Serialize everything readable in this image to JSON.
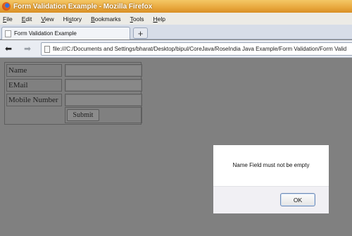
{
  "window": {
    "title": "Form Validation Example - Mozilla Firefox"
  },
  "menu": {
    "items": [
      {
        "accel": "F",
        "rest": "ile"
      },
      {
        "accel": "E",
        "rest": "dit"
      },
      {
        "accel": "V",
        "rest": "iew"
      },
      {
        "accel": "",
        "rest": "Hi",
        "accel2": "s",
        "rest2": "tory"
      },
      {
        "accel": "B",
        "rest": "ookmarks"
      },
      {
        "accel": "T",
        "rest": "ools"
      },
      {
        "accel": "H",
        "rest": "elp"
      }
    ]
  },
  "tabs": [
    {
      "label": "Form Validation Example"
    }
  ],
  "newtab_label": "+",
  "nav": {
    "back_glyph": "⬅",
    "forward_glyph": "➡",
    "url": "file:///C:/Documents and Settings/bharat/Desktop/bipul/CoreJava/RoseIndia Java Example/Form Validation/Form Valid"
  },
  "form": {
    "name_label": "Name",
    "email_label": "EMail",
    "mobile_label": "Mobile Number",
    "name_value": "",
    "email_value": "",
    "mobile_value": "",
    "submit_label": "Submit"
  },
  "alert": {
    "message": "Name Field must not be empty",
    "ok_label": "OK"
  },
  "icons": {
    "app": "firefox-logo-icon",
    "tab": "page-icon",
    "url": "page-icon"
  }
}
